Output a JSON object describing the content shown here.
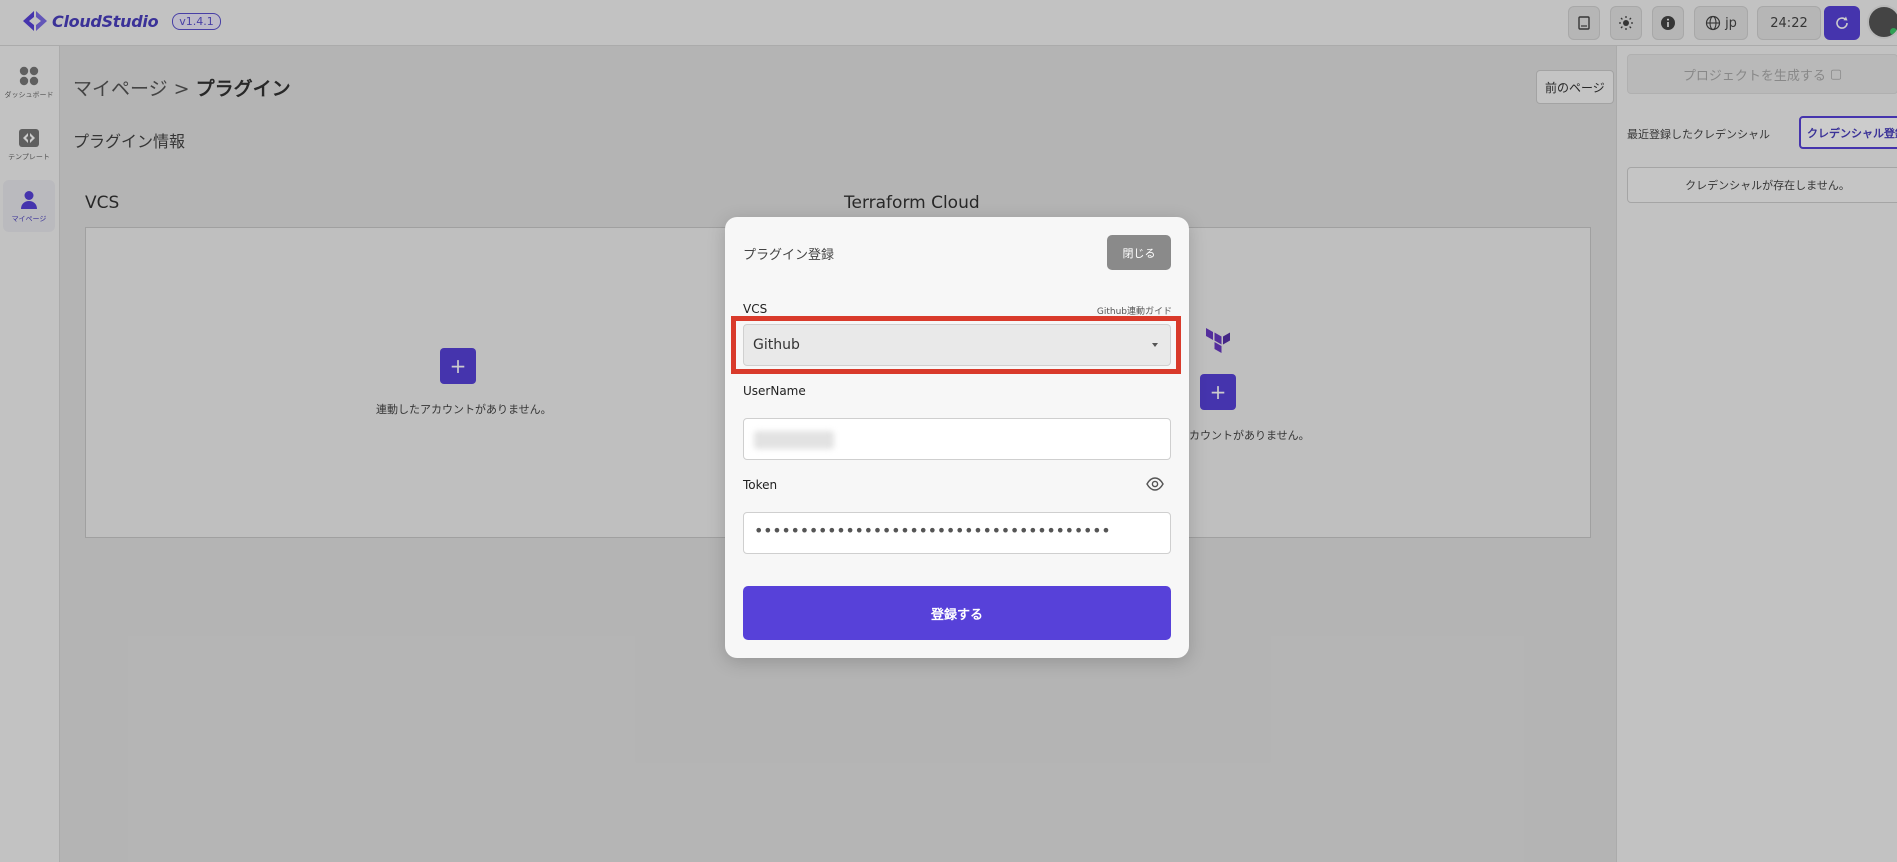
{
  "app": {
    "name": "CloudStudio",
    "version": "v1.4.1"
  },
  "toolbar": {
    "language": "jp",
    "timer": "24:22"
  },
  "sidebar": {
    "items": [
      {
        "label": "ダッシュボード",
        "icon": "dashboard-icon"
      },
      {
        "label": "テンプレート",
        "icon": "template-icon"
      },
      {
        "label": "マイページ",
        "icon": "user-icon"
      }
    ]
  },
  "page": {
    "breadcrumb_parent": "マイページ",
    "breadcrumb_sep": ">",
    "breadcrumb_current": "プラグイン",
    "prev_button": "前のページ",
    "section_title": "プラグイン情報",
    "vcs_title": "VCS",
    "terraform_title": "Terraform Cloud",
    "vcs_empty": "連動したアカウントがありません。",
    "terraform_empty": "カウントがありません。"
  },
  "right_panel": {
    "generate_button": "プロジェクトを生成する",
    "recent_label": "最近登録したクレデンシャル",
    "register_credential_button": "クレデンシャル登録",
    "no_credential": "クレデンシャルが存在しません。"
  },
  "modal": {
    "title": "プラグイン登録",
    "close_button": "閉じる",
    "vcs_label": "VCS",
    "guide_link": "Github連動ガイド",
    "vcs_selected": "Github",
    "username_label": "UserName",
    "token_label": "Token",
    "token_value": "•••••••••••••••••••••••••••••••••••••••",
    "submit_button": "登録する"
  },
  "colors": {
    "accent": "#5741d9",
    "highlight": "#d93a2b"
  }
}
